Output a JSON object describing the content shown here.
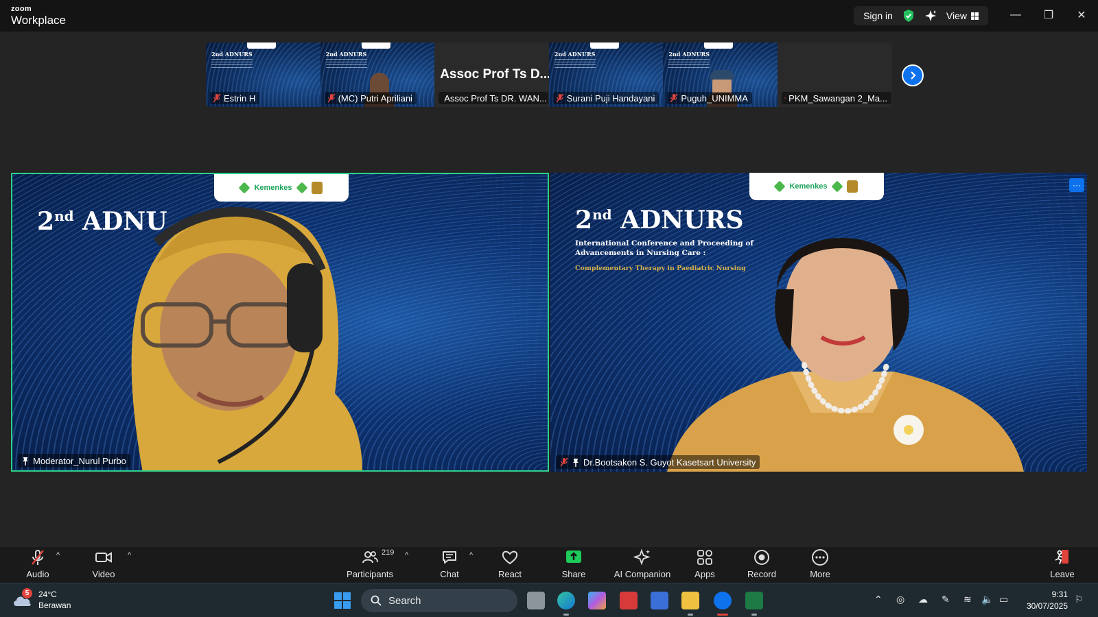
{
  "app": {
    "brand_small": "zoom",
    "brand_large": "Workplace"
  },
  "titlebar": {
    "sign_in": "Sign in",
    "view": "View",
    "minimize": "—",
    "restore": "❐",
    "close": "✕"
  },
  "thumbnails": [
    {
      "name": "Estrin H",
      "style": "slide"
    },
    {
      "name": "(MC) Putri Apriliani",
      "style": "slide-person"
    },
    {
      "name": "Assoc Prof Ts DR. WAN...",
      "display_name": "Assoc Prof Ts D...",
      "style": "name-only"
    },
    {
      "name": "Surani Puji Handayani",
      "style": "slide"
    },
    {
      "name": "Puguh_UNIMMA",
      "style": "slide-person-hat"
    },
    {
      "name": "PKM_Sawangan 2_Ma...",
      "style": "dark"
    }
  ],
  "videos": {
    "left": {
      "name": "Moderator_Nurul Purbo",
      "title_ordinal": "2",
      "title_suffix": "nd",
      "title_word": "ADNU"
    },
    "right": {
      "name": "Dr.Bootsakon S. Guyot Kasetsart University",
      "title_ordinal": "2",
      "title_suffix": "nd",
      "title_word": "ADNURS",
      "subtitle_1": "International Conference and Proceeding of",
      "subtitle_2": "Advancements in Nursing Care :",
      "theme": "Complementary Therapy in Paediatric Nursing",
      "more": "···"
    },
    "logo_text": "Kemenkes"
  },
  "toolbar": {
    "audio": "Audio",
    "video": "Video",
    "participants": "Participants",
    "participants_count": "219",
    "chat": "Chat",
    "react": "React",
    "share": "Share",
    "ai_companion": "AI Companion",
    "apps": "Apps",
    "record": "Record",
    "more": "More",
    "leave": "Leave",
    "caret": "^"
  },
  "taskbar": {
    "weather_temp": "24°C",
    "weather_desc": "Berawan",
    "weather_badge": "5",
    "search": "Search",
    "time": "9:31",
    "date": "30/07/2025"
  },
  "colors": {
    "accent": "#0e72ed",
    "active_speaker": "#2fd08a",
    "muted": "#e0433c",
    "share": "#1ecb5a"
  }
}
